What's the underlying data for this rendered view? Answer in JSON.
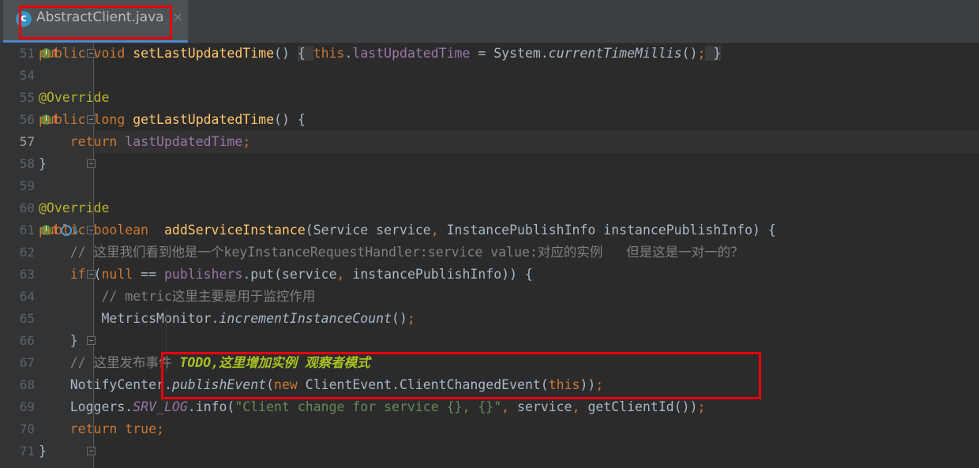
{
  "tab": {
    "icon": "c",
    "title": "AbstractClient.java",
    "close": "×"
  },
  "lines": [
    {
      "n": "51",
      "html": "<span class=\"kw\">public void </span><span class=\"fn\">setLastUpdatedTime</span>() <span class=\"br\">{ </span><span class=\"kw\">this</span>.<span class=\"fld\">lastUpdatedTime</span> = System.<span class=\"it\">currentTimeMillis</span>()<span class=\"kw\">;</span><span class=\"br\"> }</span>"
    },
    {
      "n": "54",
      "html": ""
    },
    {
      "n": "55",
      "html": "<span class=\"ann\">@Override</span>"
    },
    {
      "n": "56",
      "html": "<span class=\"kw\">public long </span><span class=\"fn\">getLastUpdatedTime</span>() {"
    },
    {
      "n": "57",
      "html": "    <span class=\"kw\">return </span><span class=\"fld\">lastUpdatedTime</span><span class=\"kw\">;</span>"
    },
    {
      "n": "58",
      "html": "}"
    },
    {
      "n": "59",
      "html": ""
    },
    {
      "n": "60",
      "html": "<span class=\"ann\">@Override</span>"
    },
    {
      "n": "61",
      "html": "<span class=\"kw\">public boolean  </span><span class=\"fn\">addServiceInstance</span>(Service service<span class=\"kw\">, </span>InstancePublishInfo instancePublishInfo) {"
    },
    {
      "n": "62",
      "html": "    <span class=\"cm\">// 这里我们看到他是一个keyInstanceRequestHandler:service value:对应的实例   但是这是一对一的？</span>"
    },
    {
      "n": "63",
      "html": "    <span class=\"kw\">if </span>(<span class=\"kw\">null </span>== <span class=\"fld\">publishers</span>.put(service<span class=\"kw\">, </span>instancePublishInfo)) {"
    },
    {
      "n": "64",
      "html": "        <span class=\"cm\">// metric这里主要是用于监控作用</span>"
    },
    {
      "n": "65",
      "html": "        MetricsMonitor.<span class=\"it\">incrementInstanceCount</span>()<span class=\"kw\">;</span>"
    },
    {
      "n": "66",
      "html": "    }"
    },
    {
      "n": "67",
      "html": "    <span class=\"cm\">// 这里发布事件 </span><span class=\"todo\">TODO,这里增加实例 观察者模式</span>"
    },
    {
      "n": "68",
      "html": "    NotifyCenter.<span class=\"it\">publishEvent</span>(<span class=\"kw\">new </span>ClientEvent.ClientChangedEvent(<span class=\"kw\">this</span>))<span class=\"kw\">;</span>"
    },
    {
      "n": "69",
      "html": "    Loggers.<span class=\"st\">SRV_LOG</span>.info(<span class=\"str\">\"Client change for service {}, {}\"</span><span class=\"kw\">, </span>service<span class=\"kw\">, </span>getClientId())<span class=\"kw\">;</span>"
    },
    {
      "n": "70",
      "html": "    <span class=\"kw\">return true;</span>"
    },
    {
      "n": "71",
      "html": "}"
    }
  ],
  "gutter_icons": {
    "51": [
      "impl",
      "up"
    ],
    "56": [
      "impl",
      "up"
    ],
    "61": [
      "impl",
      "up",
      "dbg",
      "dbg2"
    ]
  },
  "folds": [
    "51",
    "56",
    "58",
    "61",
    "63",
    "66",
    "71"
  ],
  "current_line": "57",
  "colors": {
    "background": "#2b2b2b",
    "keyword": "#cc7832",
    "method": "#ffc66d",
    "field": "#9876aa",
    "comment": "#808080",
    "annotation": "#bbb529",
    "string": "#6a8759",
    "highlight": "#e8000b"
  }
}
